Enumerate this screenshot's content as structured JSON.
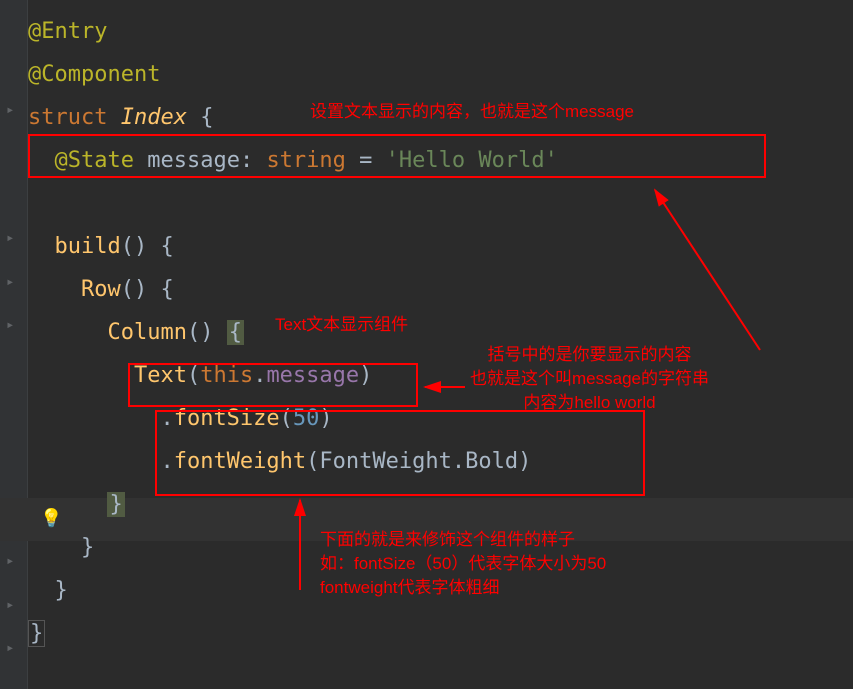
{
  "code": {
    "line1": "@Entry",
    "line2": "@Component",
    "line3_struct": "struct",
    "line3_name": " Index ",
    "line3_brace": "{",
    "line4_state": "@State",
    "line4_msg": " message: ",
    "line4_type": "string",
    "line4_eq": " = ",
    "line4_str": "'Hello World'",
    "line6_build": "build",
    "line6_rest": "() {",
    "line7_row": "Row",
    "line7_rest": "() {",
    "line8_col": "Column",
    "line8_rest": "() ",
    "line8_brace": "{",
    "line9_text": "Text",
    "line9_p1": "(",
    "line9_this": "this",
    "line9_dot": ".",
    "line9_msg": "message",
    "line9_p2": ")",
    "line10_dot": ".",
    "line10_fs": "fontSize",
    "line10_p1": "(",
    "line10_num": "50",
    "line10_p2": ")",
    "line11_dot": ".",
    "line11_fw": "fontWeight",
    "line11_p1": "(",
    "line11_enum": "FontWeight.Bold",
    "line11_p2": ")",
    "line12_brace": "}",
    "line13_brace": "}",
    "line14_brace": "}",
    "line15_brace": "}"
  },
  "annotations": {
    "a1": "设置文本显示的内容，也就是这个message",
    "a2": "Text文本显示组件",
    "a3_l1": "括号中的是你要显示的内容",
    "a3_l2": "也就是这个叫message的字符串",
    "a3_l3": "内容为hello world",
    "a4_l1": "下面的就是来修饰这个组件的样子",
    "a4_l2": "如：fontSize（50）代表字体大小为50",
    "a4_l3": "fontweight代表字体粗细"
  }
}
